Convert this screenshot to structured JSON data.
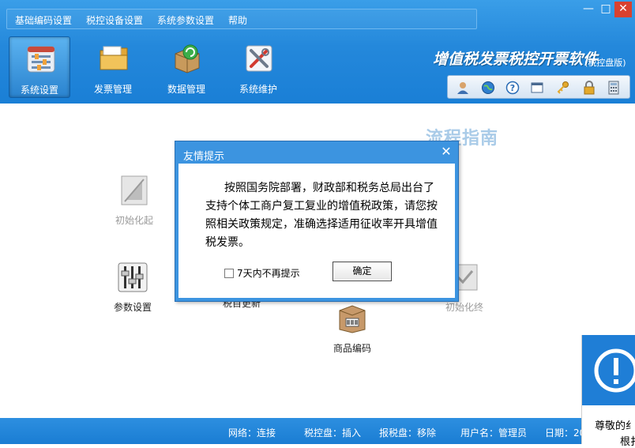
{
  "menu": {
    "items": [
      "基础编码设置",
      "税控设备设置",
      "系统参数设置",
      "帮助"
    ]
  },
  "window_controls": {
    "minimize": "—",
    "maximize": "□",
    "close": "✕"
  },
  "toolbar": {
    "items": [
      {
        "label": "系统设置",
        "icon": "settings-panel-icon",
        "active": true
      },
      {
        "label": "发票管理",
        "icon": "folder-icon",
        "active": false
      },
      {
        "label": "数据管理",
        "icon": "data-box-icon",
        "active": false
      },
      {
        "label": "系统维护",
        "icon": "maintenance-tools-icon",
        "active": false
      }
    ]
  },
  "brand": {
    "title": "增值税发票税控开票软件",
    "subtitle": "(税控盘版)"
  },
  "mini_toolbar": {
    "icons": [
      "user-icon",
      "globe-icon",
      "help-icon",
      "window-icon",
      "key-icon",
      "lock-icon",
      "calculator-icon"
    ]
  },
  "main": {
    "guide_title": "流程指南",
    "functions": {
      "init_start": "初始化起",
      "param_settings": "参数设置",
      "tax_update": "税目更新",
      "init_end": "初始化终",
      "product_code": "商品编码"
    }
  },
  "dialog": {
    "title": "友情提示",
    "close": "✕",
    "message": "按照国务院部署，财政部和税务总局出台了支持个体工商户复工复业的增值税政策，请您按照相关政策规定，准确选择适用征收率开具增值税发票。",
    "checkbox_label": "7天内不再提示",
    "checkbox_checked": false,
    "ok_label": "确定"
  },
  "status": {
    "network": "网络：连接",
    "tax_disk": "税控盘：插入",
    "report_disk": "报税盘：移除",
    "username": "用户名：管理员",
    "date": "日期：20"
  },
  "notice": {
    "text_line1": "尊敬的纟",
    "text_line2": "根扌"
  },
  "colors": {
    "header_blue": "#2488db",
    "status_blue": "#1a7dd3",
    "dialog_blue": "#3c94e0",
    "guide_title": "#a9cbe8",
    "notice_band": "#1f7ed6"
  }
}
